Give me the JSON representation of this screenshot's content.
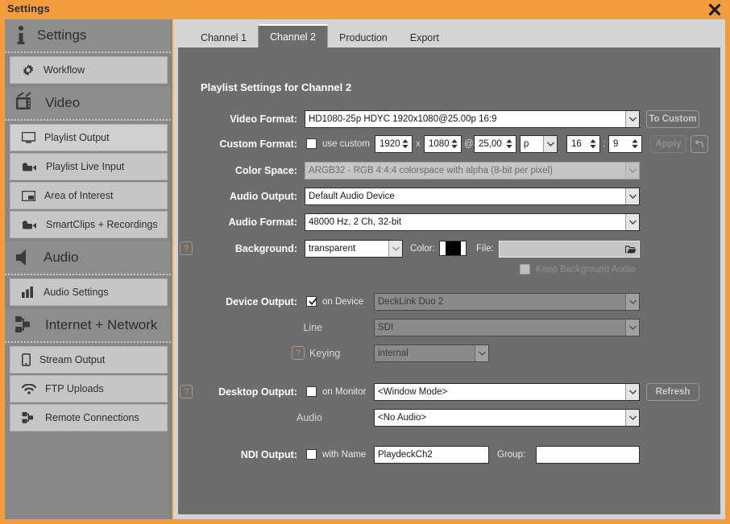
{
  "window": {
    "title": "Settings",
    "close_icon": "close-icon"
  },
  "sidebar": {
    "groups": [
      {
        "label": "Settings",
        "icon": "info-icon"
      },
      {
        "label": "Video",
        "icon": "tv-icon"
      },
      {
        "label": "Audio",
        "icon": "speaker-icon"
      },
      {
        "label": "Internet + Network",
        "icon": "network-icon"
      }
    ],
    "items": [
      {
        "label": "Workflow",
        "icon": "gear-icon",
        "group": 0,
        "active": false
      },
      {
        "label": "Playlist Output",
        "icon": "monitor-icon",
        "group": 1,
        "active": true
      },
      {
        "label": "Playlist Live Input",
        "icon": "camera-icon",
        "group": 1,
        "active": false
      },
      {
        "label": "Area of Interest",
        "icon": "frame-icon",
        "group": 1,
        "active": false
      },
      {
        "label": "SmartClips + Recordings",
        "icon": "camera-icon",
        "group": 1,
        "active": false
      },
      {
        "label": "Audio Settings",
        "icon": "bars-icon",
        "group": 2,
        "active": false
      },
      {
        "label": "Stream Output",
        "icon": "phone-icon",
        "group": 3,
        "active": false
      },
      {
        "label": "FTP Uploads",
        "icon": "wifi-icon",
        "group": 3,
        "active": false
      },
      {
        "label": "Remote Connections",
        "icon": "network-icon",
        "group": 3,
        "active": false
      }
    ]
  },
  "tabs": [
    {
      "label": "Channel 1",
      "active": false
    },
    {
      "label": "Channel 2",
      "active": true
    },
    {
      "label": "Production",
      "active": false
    },
    {
      "label": "Export",
      "active": false
    }
  ],
  "panel": {
    "title": "Playlist Settings for Channel 2"
  },
  "form": {
    "video_format": {
      "label": "Video Format:",
      "value": "HD1080-25p HDYC 1920x1080@25.00p 16:9",
      "to_custom_button": "To Custom"
    },
    "custom_format": {
      "label": "Custom Format:",
      "use_custom_label": "use custom",
      "use_custom_checked": false,
      "width": "1920",
      "x_separator": "x",
      "height": "1080",
      "at_separator": "@",
      "fps": "25,00",
      "scan": "p",
      "aspect_w": "16",
      "aspect_colon": ":",
      "aspect_h": "9",
      "apply_button": "Apply",
      "revert_icon": "revert-arrow-icon"
    },
    "color_space": {
      "label": "Color Space:",
      "value": "ARGB32 - RGB 4:4:4 colorspace with alpha (8-bit per pixel)",
      "disabled": true
    },
    "audio_output": {
      "label": "Audio Output:",
      "value": "Default Audio Device"
    },
    "audio_format": {
      "label": "Audio Format:",
      "value": "48000 Hz, 2 Ch, 32-bit"
    },
    "background": {
      "label": "Background:",
      "help_icon": "help-icon",
      "mode": "transparent",
      "color_label": "Color:",
      "color_value": "#000000",
      "file_label": "File:",
      "file_value": "",
      "browse_icon": "folder-open-icon",
      "keep_audio_label": "Keep Background Audio",
      "keep_audio_checked": false,
      "keep_audio_disabled": true
    },
    "device_output": {
      "label": "Device Output:",
      "on_device_label": "on Device",
      "on_device_checked": true,
      "device_value": "DeckLink Duo 2",
      "line_label": "Line",
      "line_value": "SDI",
      "keying_label": "Keying",
      "keying_help_icon": "help-icon",
      "keying_value": "internal"
    },
    "desktop_output": {
      "label": "Desktop Output:",
      "help_icon": "help-icon",
      "on_monitor_label": "on Monitor",
      "on_monitor_checked": false,
      "monitor_value": "<Window Mode>",
      "refresh_button": "Refresh",
      "audio_label": "Audio",
      "audio_value": "<No Audio>"
    },
    "ndi_output": {
      "label": "NDI Output:",
      "with_name_label": "with Name",
      "with_name_checked": false,
      "name_value": "PlaydeckCh2",
      "group_label": "Group:",
      "group_value": ""
    }
  },
  "colors": {
    "accent": "#f39c3d",
    "panel": "#6d6d6d",
    "sidebar": "#878787",
    "item": "#c6c6c6"
  }
}
